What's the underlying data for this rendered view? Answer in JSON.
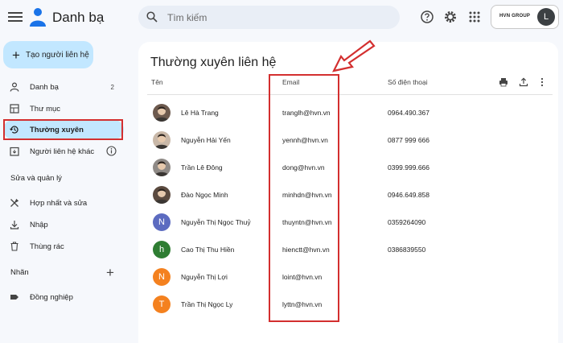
{
  "header": {
    "title": "Danh bạ",
    "search_placeholder": "Tìm kiếm",
    "org_name": "HVN GROUP",
    "avatar_initial": "L"
  },
  "sidebar": {
    "create_label": "Tạo người liên hệ",
    "items": [
      {
        "label": "Danh bạ",
        "count": "2",
        "icon": "person-icon"
      },
      {
        "label": "Thư mục",
        "icon": "folder-icon"
      },
      {
        "label": "Thường xuyên",
        "icon": "history-icon",
        "active": true
      },
      {
        "label": "Người liên hệ khác",
        "icon": "contact-add-icon"
      }
    ],
    "section_fix": "Sửa và quản lý",
    "fix_items": [
      {
        "label": "Hợp nhất và sửa",
        "icon": "tools-icon"
      },
      {
        "label": "Nhập",
        "icon": "download-icon"
      },
      {
        "label": "Thùng rác",
        "icon": "trash-icon"
      }
    ],
    "section_labels": "Nhãn",
    "label_items": [
      {
        "label": "Đồng nghiệp",
        "icon": "label-icon"
      }
    ]
  },
  "main": {
    "title": "Thường xuyên liên hệ",
    "columns": {
      "name": "Tên",
      "email": "Email",
      "phone": "Số điện thoại"
    },
    "contacts": [
      {
        "name": "Lê Hà Trang",
        "email": "tranglh@hvn.vn",
        "phone": "0964.490.367",
        "avatar": "photo",
        "color": "#6d5a4e"
      },
      {
        "name": "Nguyễn Hải Yến",
        "email": "yennh@hvn.vn",
        "phone": "0877 999 666",
        "avatar": "photo",
        "color": "#c9b8a8"
      },
      {
        "name": "Trần Lê Đông",
        "email": "dong@hvn.vn",
        "phone": "0399.999.666",
        "avatar": "photo",
        "color": "#8f8a86"
      },
      {
        "name": "Đào Ngọc Minh",
        "email": "minhdn@hvn.vn",
        "phone": "0946.649.858",
        "avatar": "photo",
        "color": "#5b4a3f"
      },
      {
        "name": "Nguyễn Thị Ngọc Thuỷ",
        "email": "thuyntn@hvn.vn",
        "phone": "0359264090",
        "avatar": "N",
        "color": "#5c6bc0"
      },
      {
        "name": "Cao Thị Thu Hiền",
        "email": "hienctt@hvn.vn",
        "phone": "0386839550",
        "avatar": "h",
        "color": "#2e7d32"
      },
      {
        "name": "Nguyễn Thị Lợi",
        "email": "loint@hvn.vn",
        "phone": "",
        "avatar": "N",
        "color": "#f4811f"
      },
      {
        "name": "Trần Thị Ngọc Ly",
        "email": "lyttn@hvn.vn",
        "phone": "",
        "avatar": "T",
        "color": "#f4811f"
      }
    ]
  },
  "colors": {
    "accent": "#c2e7ff",
    "highlight": "#d32f2f"
  }
}
